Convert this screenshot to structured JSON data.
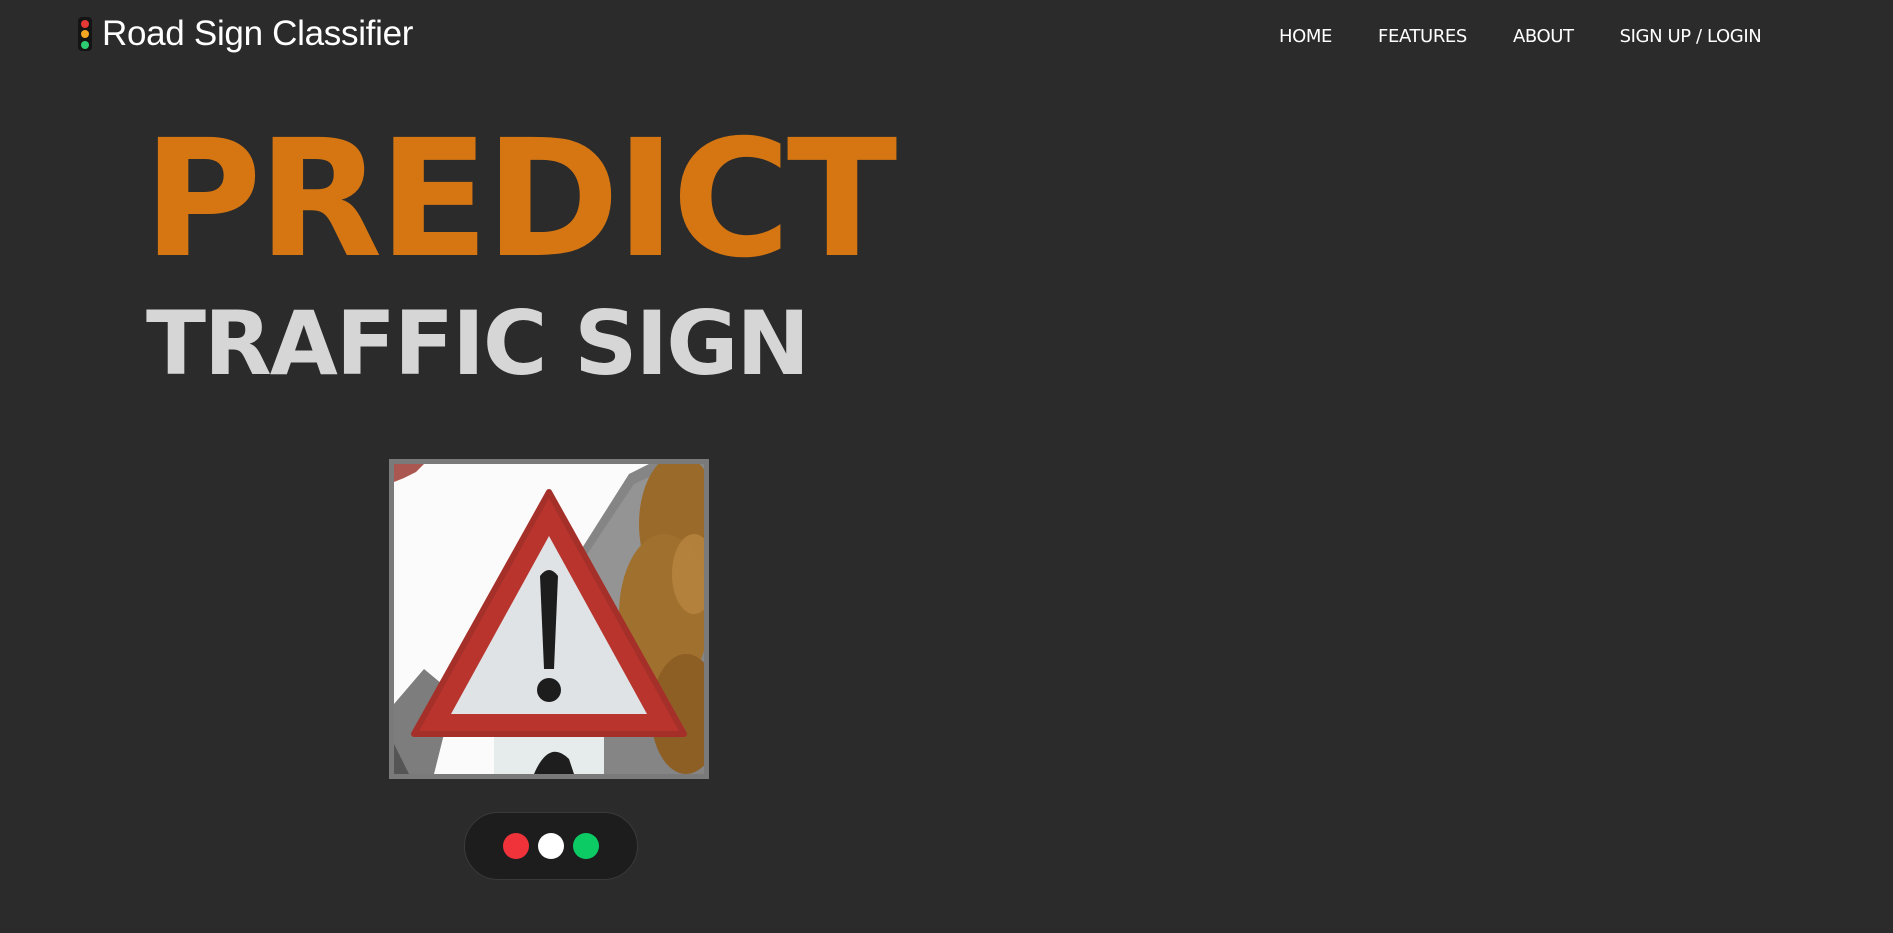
{
  "brand": {
    "icon": "traffic-light-icon",
    "name": "Road Sign Classifier",
    "lamp_colors": [
      "#e53935",
      "#f5a623",
      "#2ecc71"
    ]
  },
  "nav": {
    "items": [
      {
        "label": "HOME"
      },
      {
        "label": "FEATURES"
      },
      {
        "label": "ABOUT"
      },
      {
        "label": "SIGN UP / LOGIN"
      }
    ]
  },
  "hero": {
    "line1": "PREDICT",
    "line2": "TRAFFIC SIGN"
  },
  "image": {
    "alt": "Warning road sign: red triangle with exclamation mark"
  },
  "dots": [
    {
      "color": "#f0333a"
    },
    {
      "color": "#ffffff"
    },
    {
      "color": "#0ccb64"
    }
  ],
  "colors": {
    "background": "#2b2b2b",
    "accent": "#d57612",
    "headline_secondary": "#d6d6d6",
    "frame_border": "#7a7a7a"
  }
}
